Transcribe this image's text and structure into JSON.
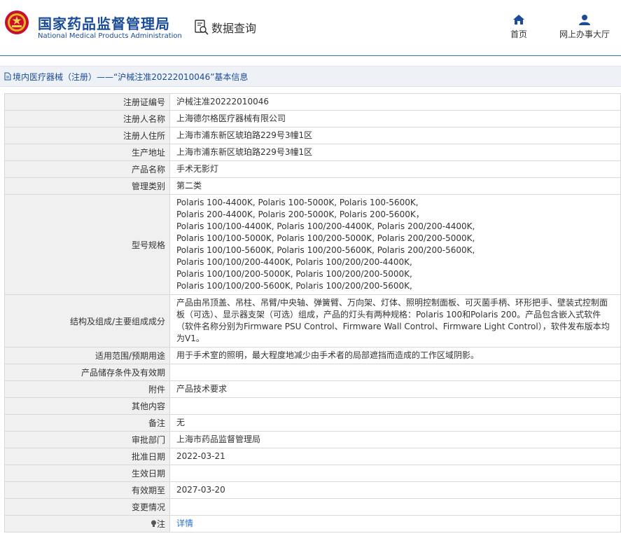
{
  "header": {
    "title_cn": "国家药品监督管理局",
    "title_en": "National Medical Products Administration",
    "query_label": "数据查询",
    "nav": [
      {
        "label": "首页",
        "icon": "home-icon"
      },
      {
        "label": "网上办事大厅",
        "icon": "user-icon"
      }
    ]
  },
  "breadcrumb": {
    "text": "境内医疗器械（注册）——“沪械注准20222010046”基本信息"
  },
  "colors": {
    "brand": "#1a4c99",
    "link": "#2b74c7",
    "label_bg": "#f0f0f0"
  },
  "table": {
    "reg_no_label": "注册证编号",
    "reg_no": "沪械注准20222010046",
    "registrant_label": "注册人名称",
    "registrant": "上海德尔格医疗器械有限公司",
    "registrant_addr_label": "注册人住所",
    "registrant_addr": "上海市浦东新区琥珀路229号3幢1区",
    "production_addr_label": "生产地址",
    "production_addr": "上海市浦东新区琥珀路229号3幢1区",
    "product_name_label": "产品名称",
    "product_name": "手术无影灯",
    "category_label": "管理类别",
    "category": "第二类",
    "model_label": "型号规格",
    "model_lines": [
      "Polaris 100-4400K, Polaris 100-5000K, Polaris 100-5600K,",
      "Polaris 200-4400K, Polaris 200-5000K, Polaris 200-5600K，",
      "Polaris 100/100-4400K, Polaris 100/200-4400K, Polaris 200/200-4400K,",
      "Polaris 100/100-5000K, Polaris 100/200-5000K, Polaris 200/200-5000K,",
      "Polaris 100/100-5600K, Polaris 100/200-5600K, Polaris 200/200-5600K,",
      "Polaris 100/100/200-4400K, Polaris 100/200/200-4400K,",
      "Polaris 100/100/200-5000K, Polaris 100/200/200-5000K,",
      "Polaris 100/100/200-5600K, Polaris 100/200/200-5600K,"
    ],
    "structure_label": "结构及组成/主要组成成分",
    "structure_lines": [
      "产品由吊顶盖、吊柱、吊臂/中央轴、弹簧臂、万向架、灯体、照明控制面板、可灭菌手柄、环形把手、壁装式控制面",
      "板（可选）、显示器支架（可选）组成，产品的灯头有两种规格：Polaris 100和Polaris 200。产品包含嵌入式软件",
      "（软件名称分别为Firmware PSU Control、Firmware Wall Control、Firmware Light Control），软件发布版本均",
      "为V1。"
    ],
    "scope_label": "适用范围/预期用途",
    "scope": "用于手术室的照明，最大程度地减少由手术者的局部遮挡而造成的工作区域阴影。",
    "storage_label": "产品储存条件及有效期",
    "storage": "",
    "attachment_label": "附件",
    "attachment": "产品技术要求",
    "other_label": "其他内容",
    "other": "",
    "remark_label": "备注",
    "remark": "无",
    "dept_label": "审批部门",
    "dept": "上海市药品监督管理局",
    "approval_date_label": "批准日期",
    "approval_date": "2022-03-21",
    "effective_date_label": "生效日期",
    "effective_date": "",
    "valid_until_label": "有效期至",
    "valid_until": "2027-03-20",
    "change_label": "变更情况",
    "change": "",
    "note_label": "注",
    "note_link": "详情"
  }
}
